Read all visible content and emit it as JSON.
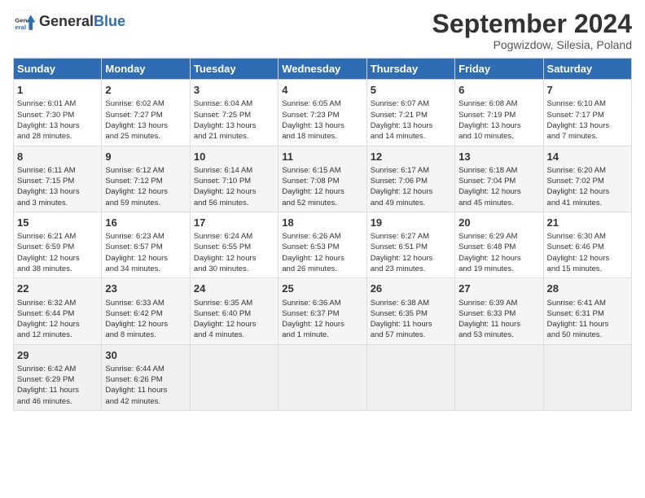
{
  "header": {
    "logo_general": "General",
    "logo_blue": "Blue",
    "month": "September 2024",
    "location": "Pogwizdow, Silesia, Poland"
  },
  "columns": [
    "Sunday",
    "Monday",
    "Tuesday",
    "Wednesday",
    "Thursday",
    "Friday",
    "Saturday"
  ],
  "rows": [
    [
      {
        "day": "1",
        "lines": [
          "Sunrise: 6:01 AM",
          "Sunset: 7:30 PM",
          "Daylight: 13 hours",
          "and 28 minutes."
        ]
      },
      {
        "day": "2",
        "lines": [
          "Sunrise: 6:02 AM",
          "Sunset: 7:27 PM",
          "Daylight: 13 hours",
          "and 25 minutes."
        ]
      },
      {
        "day": "3",
        "lines": [
          "Sunrise: 6:04 AM",
          "Sunset: 7:25 PM",
          "Daylight: 13 hours",
          "and 21 minutes."
        ]
      },
      {
        "day": "4",
        "lines": [
          "Sunrise: 6:05 AM",
          "Sunset: 7:23 PM",
          "Daylight: 13 hours",
          "and 18 minutes."
        ]
      },
      {
        "day": "5",
        "lines": [
          "Sunrise: 6:07 AM",
          "Sunset: 7:21 PM",
          "Daylight: 13 hours",
          "and 14 minutes."
        ]
      },
      {
        "day": "6",
        "lines": [
          "Sunrise: 6:08 AM",
          "Sunset: 7:19 PM",
          "Daylight: 13 hours",
          "and 10 minutes."
        ]
      },
      {
        "day": "7",
        "lines": [
          "Sunrise: 6:10 AM",
          "Sunset: 7:17 PM",
          "Daylight: 13 hours",
          "and 7 minutes."
        ]
      }
    ],
    [
      {
        "day": "8",
        "lines": [
          "Sunrise: 6:11 AM",
          "Sunset: 7:15 PM",
          "Daylight: 13 hours",
          "and 3 minutes."
        ]
      },
      {
        "day": "9",
        "lines": [
          "Sunrise: 6:12 AM",
          "Sunset: 7:12 PM",
          "Daylight: 12 hours",
          "and 59 minutes."
        ]
      },
      {
        "day": "10",
        "lines": [
          "Sunrise: 6:14 AM",
          "Sunset: 7:10 PM",
          "Daylight: 12 hours",
          "and 56 minutes."
        ]
      },
      {
        "day": "11",
        "lines": [
          "Sunrise: 6:15 AM",
          "Sunset: 7:08 PM",
          "Daylight: 12 hours",
          "and 52 minutes."
        ]
      },
      {
        "day": "12",
        "lines": [
          "Sunrise: 6:17 AM",
          "Sunset: 7:06 PM",
          "Daylight: 12 hours",
          "and 49 minutes."
        ]
      },
      {
        "day": "13",
        "lines": [
          "Sunrise: 6:18 AM",
          "Sunset: 7:04 PM",
          "Daylight: 12 hours",
          "and 45 minutes."
        ]
      },
      {
        "day": "14",
        "lines": [
          "Sunrise: 6:20 AM",
          "Sunset: 7:02 PM",
          "Daylight: 12 hours",
          "and 41 minutes."
        ]
      }
    ],
    [
      {
        "day": "15",
        "lines": [
          "Sunrise: 6:21 AM",
          "Sunset: 6:59 PM",
          "Daylight: 12 hours",
          "and 38 minutes."
        ]
      },
      {
        "day": "16",
        "lines": [
          "Sunrise: 6:23 AM",
          "Sunset: 6:57 PM",
          "Daylight: 12 hours",
          "and 34 minutes."
        ]
      },
      {
        "day": "17",
        "lines": [
          "Sunrise: 6:24 AM",
          "Sunset: 6:55 PM",
          "Daylight: 12 hours",
          "and 30 minutes."
        ]
      },
      {
        "day": "18",
        "lines": [
          "Sunrise: 6:26 AM",
          "Sunset: 6:53 PM",
          "Daylight: 12 hours",
          "and 26 minutes."
        ]
      },
      {
        "day": "19",
        "lines": [
          "Sunrise: 6:27 AM",
          "Sunset: 6:51 PM",
          "Daylight: 12 hours",
          "and 23 minutes."
        ]
      },
      {
        "day": "20",
        "lines": [
          "Sunrise: 6:29 AM",
          "Sunset: 6:48 PM",
          "Daylight: 12 hours",
          "and 19 minutes."
        ]
      },
      {
        "day": "21",
        "lines": [
          "Sunrise: 6:30 AM",
          "Sunset: 6:46 PM",
          "Daylight: 12 hours",
          "and 15 minutes."
        ]
      }
    ],
    [
      {
        "day": "22",
        "lines": [
          "Sunrise: 6:32 AM",
          "Sunset: 6:44 PM",
          "Daylight: 12 hours",
          "and 12 minutes."
        ]
      },
      {
        "day": "23",
        "lines": [
          "Sunrise: 6:33 AM",
          "Sunset: 6:42 PM",
          "Daylight: 12 hours",
          "and 8 minutes."
        ]
      },
      {
        "day": "24",
        "lines": [
          "Sunrise: 6:35 AM",
          "Sunset: 6:40 PM",
          "Daylight: 12 hours",
          "and 4 minutes."
        ]
      },
      {
        "day": "25",
        "lines": [
          "Sunrise: 6:36 AM",
          "Sunset: 6:37 PM",
          "Daylight: 12 hours",
          "and 1 minute."
        ]
      },
      {
        "day": "26",
        "lines": [
          "Sunrise: 6:38 AM",
          "Sunset: 6:35 PM",
          "Daylight: 11 hours",
          "and 57 minutes."
        ]
      },
      {
        "day": "27",
        "lines": [
          "Sunrise: 6:39 AM",
          "Sunset: 6:33 PM",
          "Daylight: 11 hours",
          "and 53 minutes."
        ]
      },
      {
        "day": "28",
        "lines": [
          "Sunrise: 6:41 AM",
          "Sunset: 6:31 PM",
          "Daylight: 11 hours",
          "and 50 minutes."
        ]
      }
    ],
    [
      {
        "day": "29",
        "lines": [
          "Sunrise: 6:42 AM",
          "Sunset: 6:29 PM",
          "Daylight: 11 hours",
          "and 46 minutes."
        ]
      },
      {
        "day": "30",
        "lines": [
          "Sunrise: 6:44 AM",
          "Sunset: 6:26 PM",
          "Daylight: 11 hours",
          "and 42 minutes."
        ]
      },
      null,
      null,
      null,
      null,
      null
    ]
  ]
}
